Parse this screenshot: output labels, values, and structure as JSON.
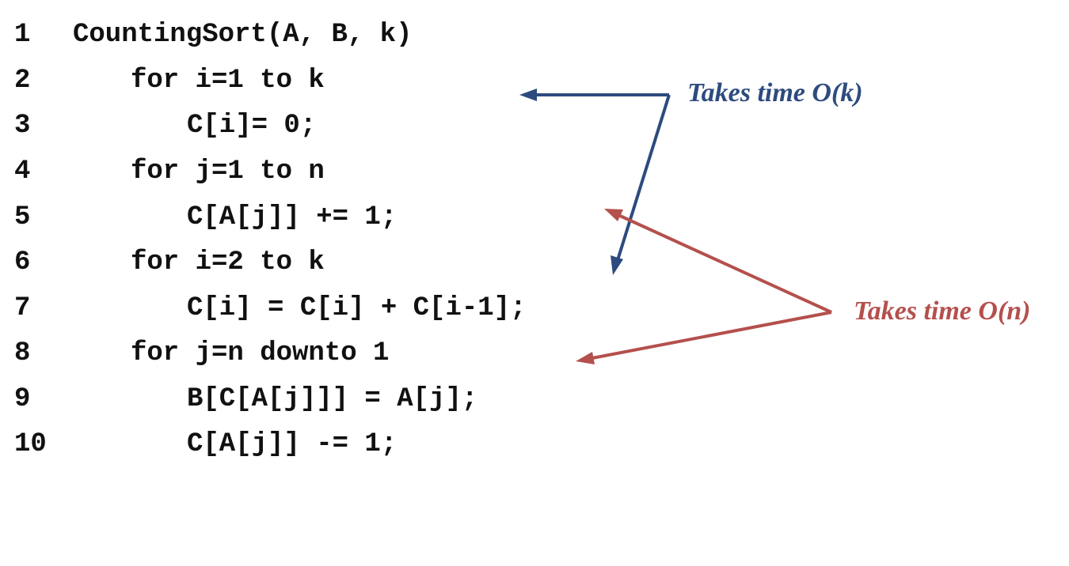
{
  "code": {
    "lines": [
      {
        "number": "1",
        "text": "CountingSort(A, B, k)"
      },
      {
        "number": "2",
        "text": "for i=1 to k"
      },
      {
        "number": "3",
        "text": "C[i]= 0;"
      },
      {
        "number": "4",
        "text": "for j=1 to n"
      },
      {
        "number": "5",
        "text": "C[A[j]] += 1;"
      },
      {
        "number": "6",
        "text": "for i=2 to k"
      },
      {
        "number": "7",
        "text": "C[i] = C[i] + C[i-1];"
      },
      {
        "number": "8",
        "text": "for j=n downto 1"
      },
      {
        "number": "9",
        "text": "B[C[A[j]]] = A[j];"
      },
      {
        "number": "10",
        "text": "C[A[j]] -= 1;"
      }
    ]
  },
  "annotations": {
    "time_k": "Takes time O(k)",
    "time_n": "Takes time O(n)"
  },
  "colors": {
    "k_annotation": "#2d4b7e",
    "n_annotation": "#b4504d",
    "code_text": "#111111"
  }
}
